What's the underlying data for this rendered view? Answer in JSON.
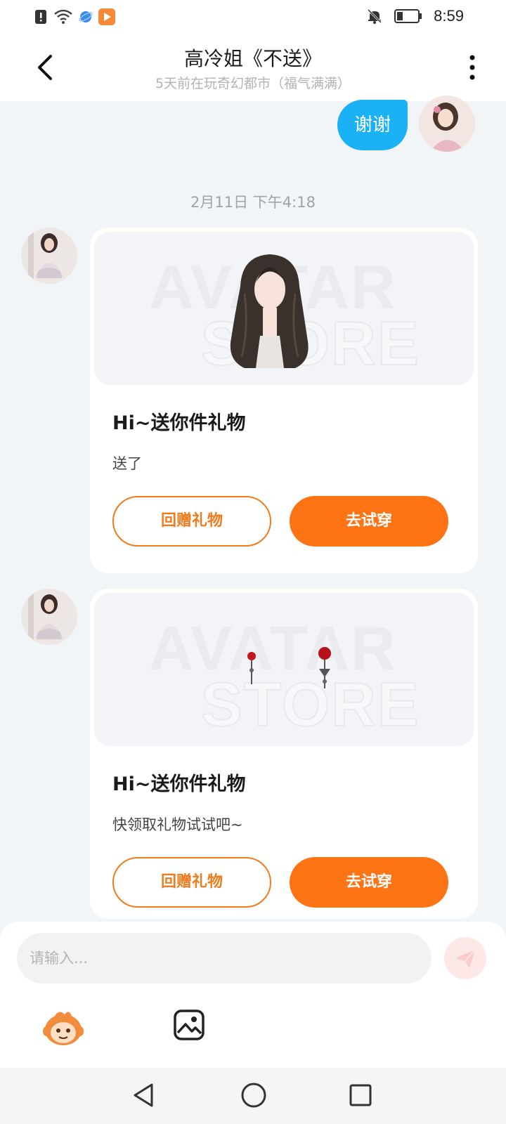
{
  "status_bar": {
    "time": "8:59",
    "icons": [
      "alert-icon",
      "wifi-icon",
      "browser-icon",
      "video-app-icon",
      "bell-off-icon",
      "battery-icon"
    ]
  },
  "header": {
    "title": "高冷姐《不送》",
    "subtitle": "5天前在玩奇幻都市（福气满满）"
  },
  "sent_message": {
    "text": "谢谢"
  },
  "timestamp": "2月11日 下午4:18",
  "cards": [
    {
      "watermark_top": "AVATAR",
      "watermark_bottom": "STORE",
      "image": "hair-item",
      "title": "Hi~送你件礼物",
      "subtitle": "送了",
      "return_label": "回赠礼物",
      "tryon_label": "去试穿"
    },
    {
      "watermark_top": "AVATAR",
      "watermark_bottom": "STORE",
      "image": "earrings-item",
      "title": "Hi~送你件礼物",
      "subtitle": "快领取礼物试试吧~",
      "return_label": "回赠礼物",
      "tryon_label": "去试穿"
    }
  ],
  "composer": {
    "placeholder": "请输入...",
    "value": "",
    "tools": [
      "emoji-icon",
      "image-icon"
    ]
  },
  "colors": {
    "accent_orange": "#fe7414",
    "bubble_blue": "#1ab2f5",
    "background": "#f2f5f8"
  }
}
